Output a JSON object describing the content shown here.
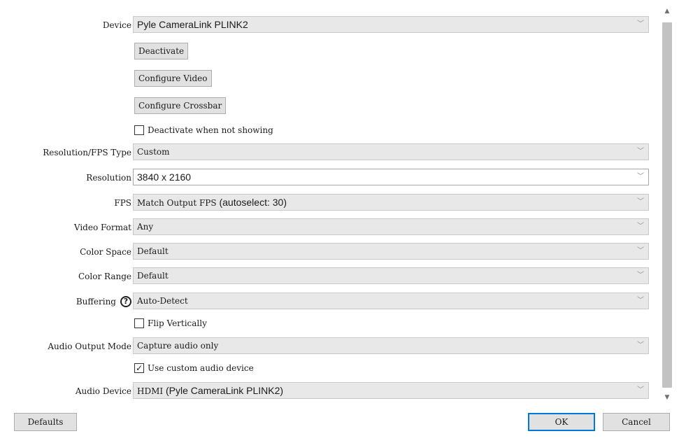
{
  "rows": {
    "device": {
      "label": "Device",
      "value": "Pyle CameraLink PLINK2"
    },
    "resolution_fps_type": {
      "label": "Resolution/FPS Type",
      "value": "Custom"
    },
    "resolution": {
      "label": "Resolution",
      "value": "3840 x 2160"
    },
    "fps": {
      "label": "FPS",
      "value_main": "Match Output FPS",
      "value_extra": " (autoselect: 30)"
    },
    "video_format": {
      "label": "Video Format",
      "value": "Any"
    },
    "color_space": {
      "label": "Color Space",
      "value": "Default"
    },
    "color_range": {
      "label": "Color Range",
      "value": "Default"
    },
    "buffering": {
      "label": "Buffering",
      "help_glyph": "?",
      "value": "Auto-Detect"
    },
    "audio_output_mode": {
      "label": "Audio Output Mode",
      "value": "Capture audio only"
    },
    "audio_device": {
      "label": "Audio Device",
      "value_main": "HDMI",
      "value_extra": " (Pyle CameraLink PLINK2)"
    }
  },
  "buttons": {
    "deactivate": "Deactivate",
    "configure_video": "Configure Video",
    "configure_crossbar": "Configure Crossbar"
  },
  "checkboxes": {
    "deactivate_when_not_showing": {
      "label": "Deactivate when not showing",
      "checked": false
    },
    "flip_vertically": {
      "label": "Flip Vertically",
      "checked": false
    },
    "use_custom_audio_device": {
      "label": "Use custom audio device",
      "checked": true
    }
  },
  "footer": {
    "defaults": "Defaults",
    "ok": "OK",
    "cancel": "Cancel"
  },
  "icons": {
    "dropdown_arrow": "chevron-down-icon",
    "check_glyph": "✓",
    "scroll_up_glyph": "▲",
    "scroll_down_glyph": "▼",
    "arrow_glyph": "﹀"
  },
  "colors": {
    "combo_bg": "#e8e8e8",
    "button_bg": "#e1e1e1",
    "default_button_border": "#0078d7",
    "scroll_thumb": "#c2c2c2"
  }
}
